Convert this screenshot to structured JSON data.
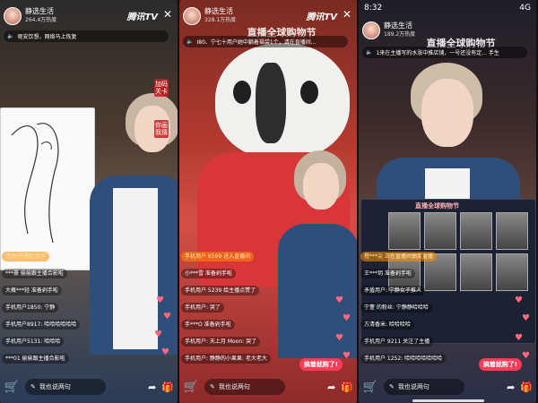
{
  "panels": [
    {
      "channel_name": "静选生活",
      "channel_heat": "264.4万热度",
      "brand": "腾讯TV",
      "notice": "呢安饮想，网络马上恢复",
      "side_note": "加码关卡",
      "side_note2": "你画我猜",
      "comments": [
        {
          "text": "请选*不想起名字",
          "style": "highlight"
        },
        {
          "text": "***豪 偷偷跟主播合影啦"
        },
        {
          "text": "大概***轻 准备剁手啦"
        },
        {
          "text": "手机用户1850: 宁静"
        },
        {
          "text": "手机用户8917: 哈哈哈哈哈哈"
        },
        {
          "text": "手机用户5131: 哈哈哈"
        },
        {
          "text": "***01 偷偷跟主播合影啦"
        }
      ],
      "buy": "",
      "input_placeholder": "我也说两句"
    },
    {
      "channel_name": "静选生活",
      "channel_heat": "328.1万热度",
      "brand": "腾讯TV",
      "banner": "直播全球购物节",
      "notice": "I80、宁七十用户她中躺着福袋1个，请在直播间...",
      "comments": [
        {
          "text": "手机用户 6599 进入直播间",
          "style": "highlight"
        },
        {
          "text": "小***雪 准备剁手啦"
        },
        {
          "text": "手机用户 5239 给主播点赞了"
        },
        {
          "text": "手机用户: 哭了"
        },
        {
          "text": "手***O 准备剁手啦"
        },
        {
          "text": "手机用户: 天上月 Moon: 哭了"
        },
        {
          "text": "手机用户: 静静的小果果: 老大老大"
        }
      ],
      "buy": "搞着就购了!",
      "input_placeholder": "我也说两句"
    },
    {
      "status_time": "8:32",
      "status_signal": "4G",
      "channel_name": "静选生活",
      "channel_heat": "189.2万热度",
      "banner": "直播全球购物节",
      "notice": "1来在主播写的水涨中推店铺，一号还没有定... 手生",
      "award_title": "直播全球购物节",
      "comments": [
        {
          "text": "橙***尖 正在直播间抽奖直播",
          "style": "highlight"
        },
        {
          "text": "王***玥 准备剁手啦"
        },
        {
          "text": "矛盾用户: 宁静女子推人"
        },
        {
          "text": "宁董 的粉丝: 宁静静哈哈哈"
        },
        {
          "text": "方清香米: 哈哈哈哈"
        },
        {
          "text": "手机用户 9211 关注了主播"
        },
        {
          "text": "手机用户 1252: 哈哈哈哈哈哈哈"
        }
      ],
      "buy": "搞着就购了!",
      "input_placeholder": "我也说两句"
    }
  ],
  "icons": {
    "speaker": "speaker-icon",
    "cart": "cart-icon",
    "share": "share-icon",
    "gift": "gift-icon",
    "close": "close-icon",
    "pen": "pen-icon"
  }
}
